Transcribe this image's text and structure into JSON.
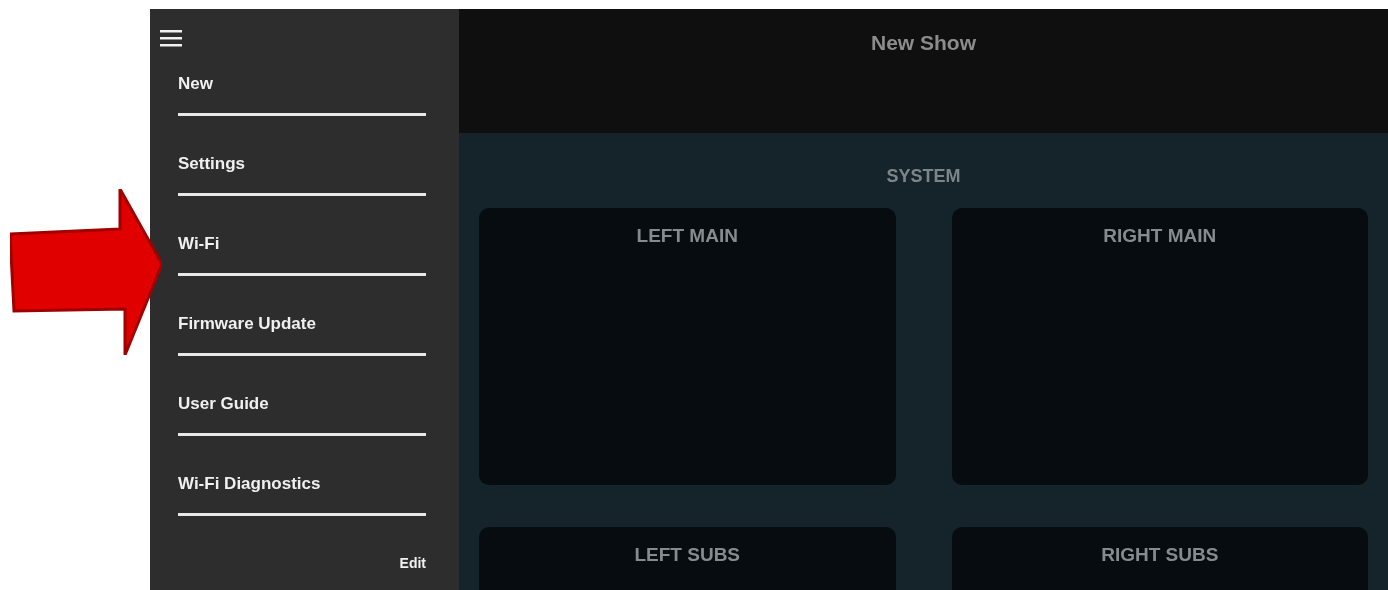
{
  "sidebar": {
    "items": [
      {
        "label": "New"
      },
      {
        "label": "Settings"
      },
      {
        "label": "Wi-Fi"
      },
      {
        "label": "Firmware Update"
      },
      {
        "label": "User Guide"
      },
      {
        "label": "Wi-Fi Diagnostics"
      }
    ],
    "edit": "Edit"
  },
  "header": {
    "title": "New Show"
  },
  "section": {
    "title": "SYSTEM",
    "cards": [
      {
        "title": "LEFT MAIN"
      },
      {
        "title": "RIGHT MAIN"
      },
      {
        "title": "LEFT SUBS"
      },
      {
        "title": "RIGHT SUBS"
      }
    ]
  }
}
